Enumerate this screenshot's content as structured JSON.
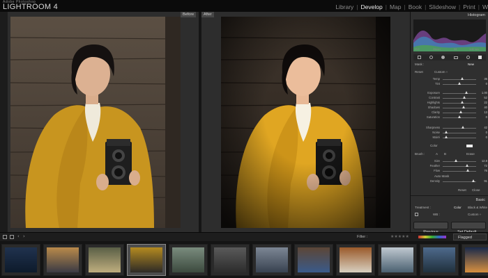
{
  "app": {
    "brand_small": "Adobe Photoshop",
    "brand": "LIGHTROOM 4"
  },
  "modules": [
    "Library",
    "Develop",
    "Map",
    "Book",
    "Slideshow",
    "Print",
    "W"
  ],
  "active_module": "Develop",
  "view": {
    "before_label": "Before",
    "after_label": "After"
  },
  "panel": {
    "histogram_title": "Histogram",
    "histogram_info": [
      "ISO",
      "35mm",
      "f/8",
      "1/40 sec"
    ],
    "basic": {
      "treatment_label": "Mask :",
      "treatment_value": "New",
      "preset_label": "Reset",
      "preset_value": "Custom ÷",
      "rows": [
        {
          "label": "Temp",
          "value": "35",
          "pos": 0.58
        },
        {
          "label": "Tint",
          "value": "0",
          "pos": 0.5
        },
        {
          "label": "Exposure",
          "value": "1.00",
          "pos": 0.7
        },
        {
          "label": "Contrast",
          "value": "52",
          "pos": 0.64
        },
        {
          "label": "Highlights",
          "value": "22",
          "pos": 0.58
        },
        {
          "label": "Shadows",
          "value": "40",
          "pos": 0.62
        },
        {
          "label": "Clarity",
          "value": "13",
          "pos": 0.54
        },
        {
          "label": "Saturation",
          "value": "0",
          "pos": 0.5
        },
        {
          "label": "Sharpness",
          "value": "42",
          "pos": 0.6
        },
        {
          "label": "Noise",
          "value": "0",
          "pos": 0.1
        },
        {
          "label": "Moiré",
          "value": "0",
          "pos": 0.1
        }
      ],
      "color_label": "Color",
      "brush_label": "Brush :",
      "brush_a": "A",
      "brush_b": "B",
      "brush_erase": "Erase",
      "brush_rows": [
        {
          "label": "Size",
          "value": "12.8",
          "pos": 0.4
        },
        {
          "label": "Feather",
          "value": "72",
          "pos": 0.72
        },
        {
          "label": "Flow",
          "value": "76",
          "pos": 0.76
        }
      ],
      "automask_label": "Auto Mask",
      "density_label": "Density",
      "density_value": "91",
      "density_pos": 0.91,
      "reset_label": "Reset",
      "close_label": "Close",
      "section_title": "Basic",
      "treatment_row_label": "Treatment :",
      "treatment_color": "Color",
      "treatment_bw": "Black & White",
      "wb_label": "WB :",
      "wb_value": "Custom ÷"
    },
    "previous_button": "Previous",
    "set_default_button": "Set Default..."
  },
  "toolbar": {
    "filter_label": "Filter :",
    "flagged_label": "Flagged",
    "stars": "★★★★★"
  },
  "filmstrip": {
    "thumbs": [
      {
        "name": "thumb-1",
        "selected": false
      },
      {
        "name": "thumb-2",
        "selected": false
      },
      {
        "name": "thumb-3",
        "selected": false
      },
      {
        "name": "thumb-4",
        "selected": true
      },
      {
        "name": "thumb-5",
        "selected": false
      },
      {
        "name": "thumb-6",
        "selected": false
      },
      {
        "name": "thumb-7",
        "selected": false
      },
      {
        "name": "thumb-8",
        "selected": false
      },
      {
        "name": "thumb-9",
        "selected": false
      },
      {
        "name": "thumb-10",
        "selected": false
      },
      {
        "name": "thumb-11",
        "selected": false
      },
      {
        "name": "thumb-12",
        "selected": false
      }
    ]
  },
  "colors": {
    "accent": "#f0f0f0",
    "panel": "#2f2f2f",
    "jacket": "#c4921e",
    "wood": "#4a4036"
  }
}
